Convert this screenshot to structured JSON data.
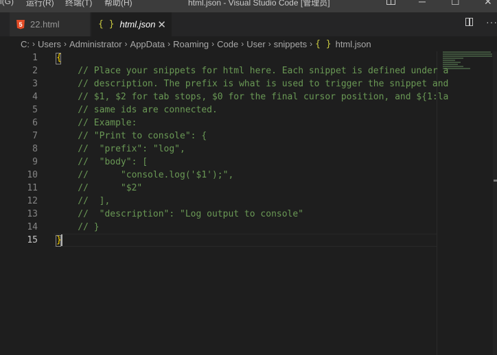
{
  "titlebar": {
    "menu": [
      "i(G)",
      "运行(R)",
      "终端(T)",
      "帮助(H)"
    ],
    "title": "html.json - Visual Studio Code [管理员]",
    "layout_icon": "layout-icon",
    "minimize_glyph": "─",
    "maximize_glyph": "☐",
    "close_glyph": "✕"
  },
  "tabs": [
    {
      "label": "22.html",
      "icon": "html5-icon",
      "icon_glyph": "5"
    },
    {
      "label": "html.json",
      "icon": "json-icon",
      "icon_glyph": "{ }",
      "close_glyph": "✕"
    }
  ],
  "actions": {
    "more_glyph": "···"
  },
  "breadcrumb": {
    "segments": [
      "C:",
      "Users",
      "Administrator",
      "AppData",
      "Roaming",
      "Code",
      "User",
      "snippets"
    ],
    "file_icon_glyph": "{ }",
    "file": "html.json",
    "separator": "›"
  },
  "editor": {
    "lines": [
      {
        "num": "1",
        "text": "{"
      },
      {
        "num": "2",
        "text": "    // Place your snippets for html here. Each snippet is defined under a"
      },
      {
        "num": "3",
        "text": "    // description. The prefix is what is used to trigger the snippet and"
      },
      {
        "num": "4",
        "text": "    // $1, $2 for tab stops, $0 for the final cursor position, and ${1:la"
      },
      {
        "num": "5",
        "text": "    // same ids are connected."
      },
      {
        "num": "6",
        "text": "    // Example:"
      },
      {
        "num": "7",
        "text": "    // \"Print to console\": {"
      },
      {
        "num": "8",
        "text": "    //  \"prefix\": \"log\","
      },
      {
        "num": "9",
        "text": "    //  \"body\": ["
      },
      {
        "num": "10",
        "text": "    //      \"console.log('$1');\","
      },
      {
        "num": "11",
        "text": "    //      \"$2\""
      },
      {
        "num": "12",
        "text": "    //  ],"
      },
      {
        "num": "13",
        "text": "    //  \"description\": \"Log output to console\""
      },
      {
        "num": "14",
        "text": "    // }"
      },
      {
        "num": "15",
        "text": "}"
      }
    ],
    "current_line": "15"
  },
  "colors": {
    "background": "#1e1e1e",
    "comment": "#6a9955",
    "bracket": "#ffd700",
    "line_number": "#858585"
  }
}
